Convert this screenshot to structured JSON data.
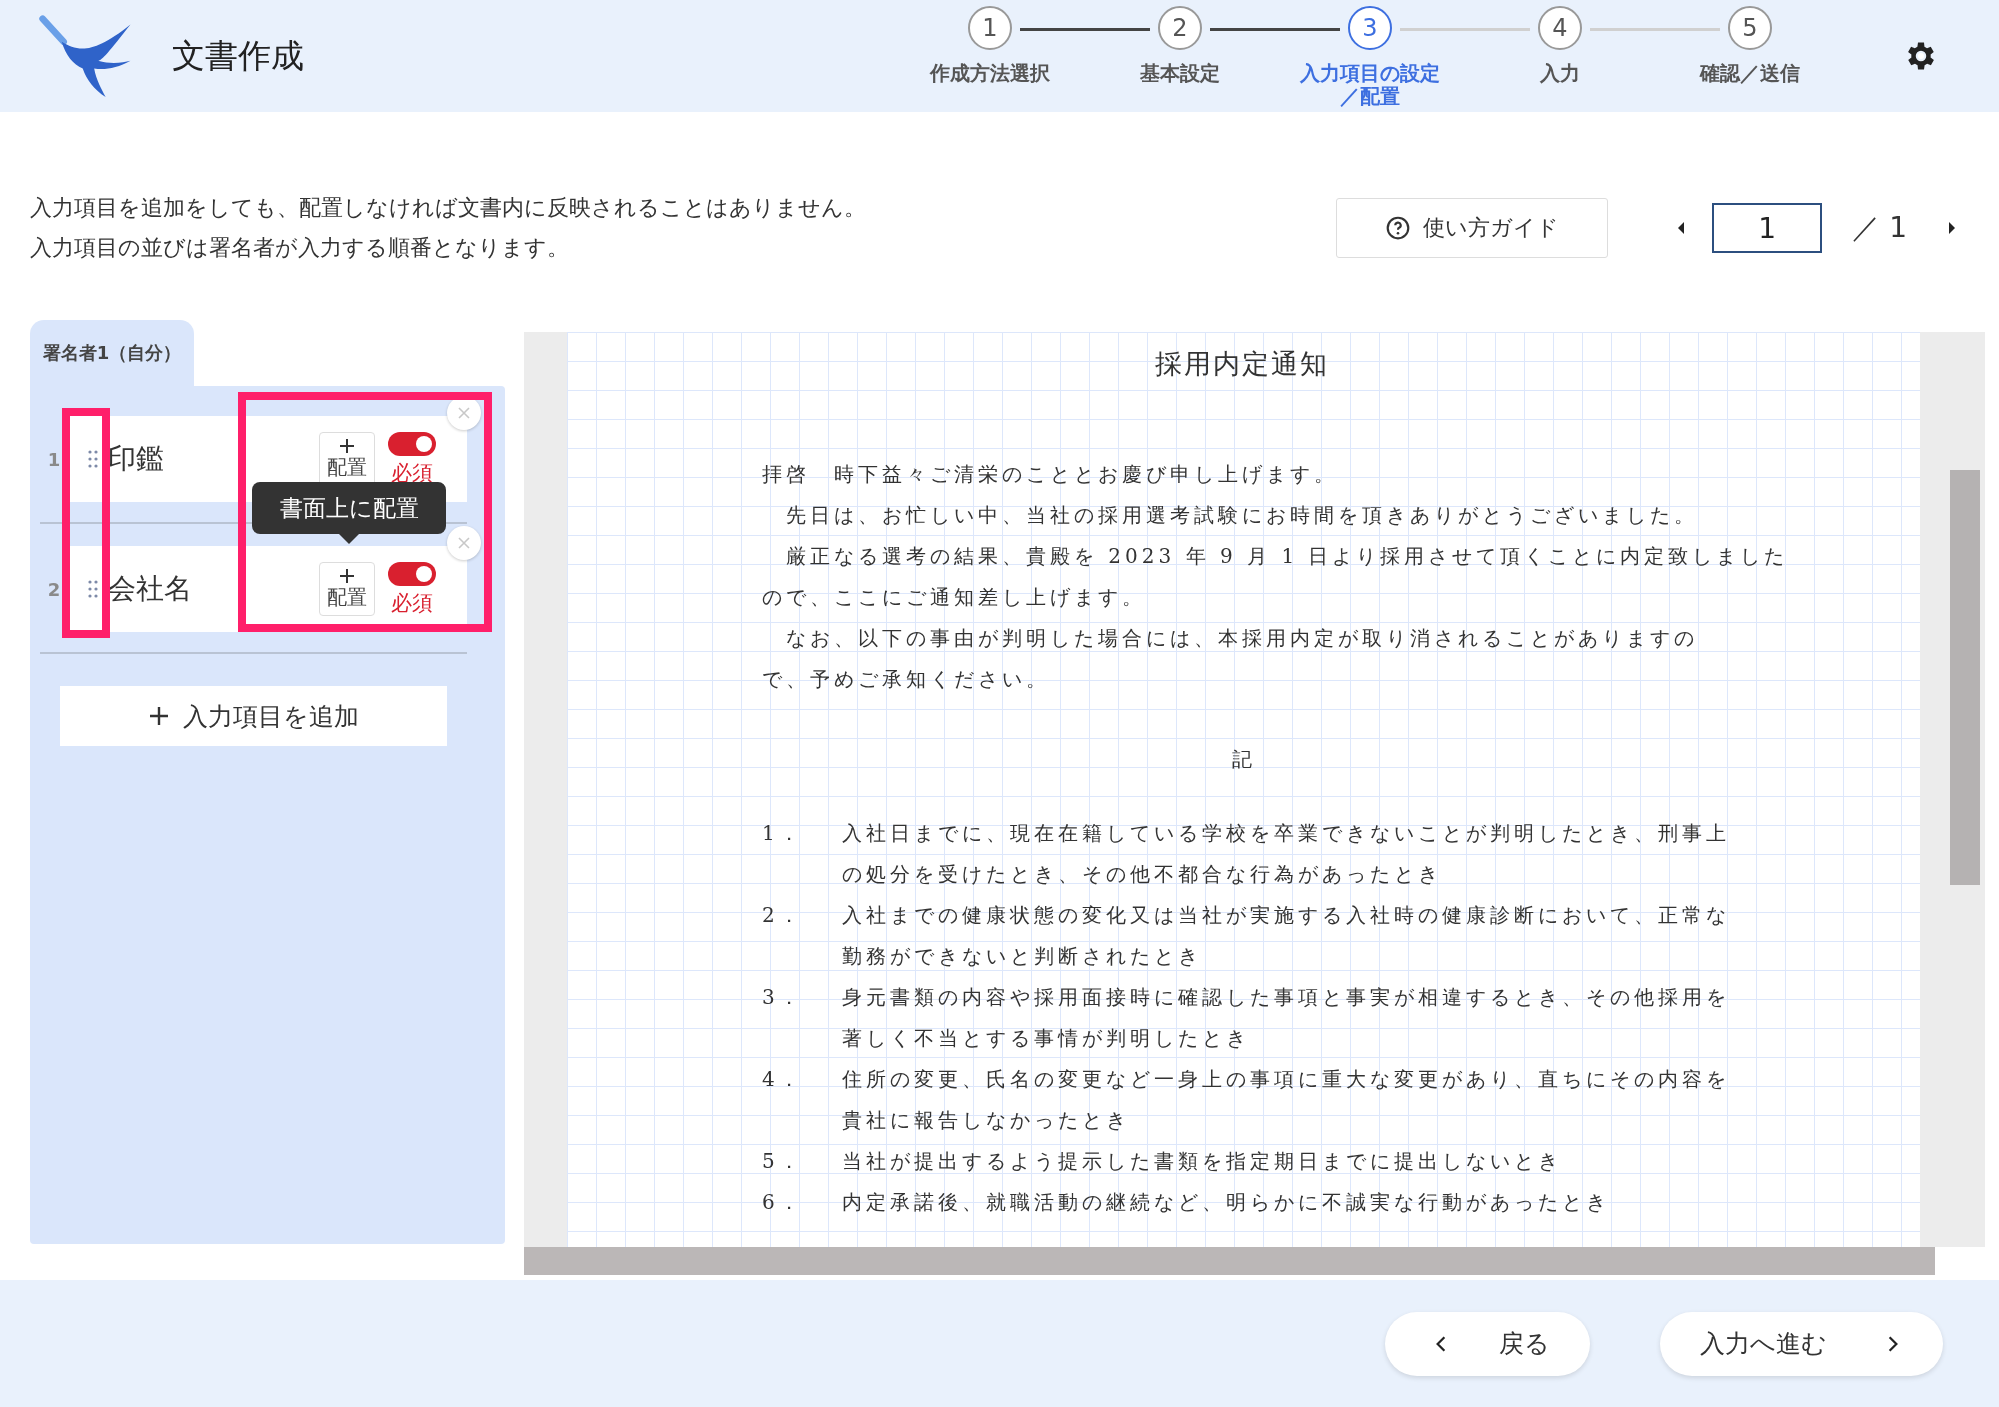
{
  "app": {
    "title": "文書作成"
  },
  "steps": [
    {
      "number": "1",
      "label": "作成方法選択",
      "selected": false,
      "completed": true
    },
    {
      "number": "2",
      "label": "基本設定",
      "selected": false,
      "completed": true
    },
    {
      "number": "3",
      "label": "入力項目の設定／配置",
      "selected": true,
      "completed": false
    },
    {
      "number": "4",
      "label": "入力",
      "selected": false,
      "completed": false
    },
    {
      "number": "5",
      "label": "確認／送信",
      "selected": false
    }
  ],
  "instructions": [
    "入力項目を追加をしても、配置しなければ文書内に反映されることはありません。",
    "入力項目の並びは署名者が入力する順番となります。"
  ],
  "guide_button": "使い方ガイド",
  "pager": {
    "value": "1",
    "total": "／ 1"
  },
  "signer_tab": {
    "label": "署名者1（自分）",
    "selected": true
  },
  "items": [
    {
      "number": "1",
      "label": "印鑑",
      "place_button": "配置",
      "required": true,
      "required_label": "必須"
    },
    {
      "number": "2",
      "label": "会社名",
      "place_button": "配置",
      "required": true,
      "required_label": "必須"
    }
  ],
  "tooltip": "書面上に配置",
  "add_button": "入力項目を追加",
  "document": {
    "title": "採用内定通知",
    "paragraphs": [
      [
        "拝啓　時下益々ご清栄のこととお慶び申し上げます。"
      ],
      [
        "　先日は、お忙しい中、当社の採用選考試験にお時間を頂きありがとうございました。"
      ],
      [
        "　厳正なる選考の結果、貴殿を 2023 年 9 月 1 日より採用させて頂くことに内定致しました",
        "ので、ここにご通知差し上げます。"
      ],
      [
        "　なお、以下の事由が判明した場合には、本採用内定が取り消されることがありますの",
        "で、予めご承知ください。"
      ]
    ],
    "section_mark": "記",
    "list": [
      {
        "number": "1．",
        "lines": [
          "入社日までに、現在在籍している学校を卒業できないことが判明したとき、刑事上",
          "の処分を受けたとき、その他不都合な行為があったとき"
        ]
      },
      {
        "number": "2．",
        "lines": [
          "入社までの健康状態の変化又は当社が実施する入社時の健康診断において、正常な",
          "勤務ができないと判断されたとき"
        ]
      },
      {
        "number": "3．",
        "lines": [
          "身元書類の内容や採用面接時に確認した事項と事実が相違するとき、その他採用を",
          "著しく不当とする事情が判明したとき"
        ]
      },
      {
        "number": "4．",
        "lines": [
          "住所の変更、氏名の変更など一身上の事項に重大な変更があり、直ちにその内容を",
          "貴社に報告しなかったとき"
        ]
      },
      {
        "number": "5．",
        "lines": [
          "当社が提出するよう提示した書類を指定期日までに提出しないとき"
        ]
      },
      {
        "number": "6．",
        "lines": [
          "内定承諾後、就職活動の継続など、明らかに不誠実な行動があったとき"
        ]
      }
    ]
  },
  "footer": {
    "back": "戻る",
    "next": "入力へ進む"
  }
}
